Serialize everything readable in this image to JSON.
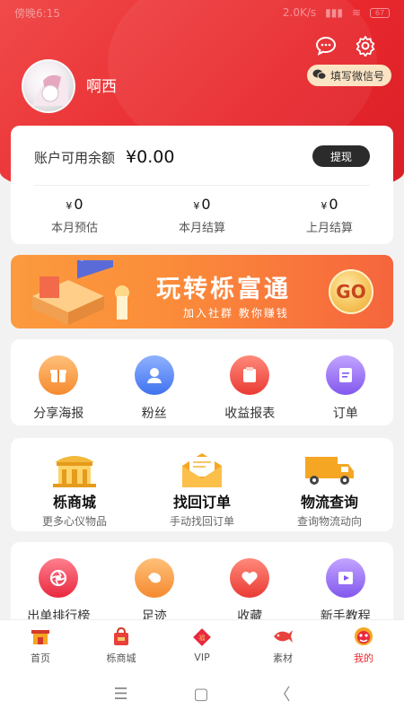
{
  "status": {
    "time": "傍晚6:15",
    "speed": "2.0K/s",
    "battery": "67"
  },
  "header": {
    "username": "啊西",
    "wechat_label": "填写微信号"
  },
  "balance": {
    "label": "账户可用余额",
    "value": "¥0.00",
    "withdraw_label": "提现",
    "stats": [
      {
        "value": "0",
        "currency": "¥",
        "label": "本月预估"
      },
      {
        "value": "0",
        "currency": "¥",
        "label": "本月结算"
      },
      {
        "value": "0",
        "currency": "¥",
        "label": "上月结算"
      }
    ]
  },
  "banner": {
    "title": "玩转栎富通",
    "subtitle": "加入社群 教你赚钱",
    "go": "GO"
  },
  "menu1": [
    {
      "label": "分享海报",
      "icon": "gift-icon",
      "color": "#f7a04a"
    },
    {
      "label": "粉丝",
      "icon": "fans-icon",
      "color": "#5b8cf5"
    },
    {
      "label": "收益报表",
      "icon": "report-icon",
      "color": "#f25a4f"
    },
    {
      "label": "订单",
      "icon": "order-icon",
      "color": "#9a72f2"
    }
  ],
  "menu2": [
    {
      "title": "栎商城",
      "subtitle": "更多心仪物品",
      "icon": "mall-icon"
    },
    {
      "title": "找回订单",
      "subtitle": "手动找回订单",
      "icon": "envelope-icon"
    },
    {
      "title": "物流查询",
      "subtitle": "查询物流动向",
      "icon": "truck-icon"
    }
  ],
  "menu3": [
    {
      "label": "出单排行榜",
      "icon": "aperture-icon",
      "color": "#f2485a"
    },
    {
      "label": "足迹",
      "icon": "footprint-icon",
      "color": "#f7a04a"
    },
    {
      "label": "收藏",
      "icon": "heart-icon",
      "color": "#f25a4f"
    },
    {
      "label": "新手教程",
      "icon": "play-icon",
      "color": "#9a72f2"
    }
  ],
  "tabs": [
    {
      "label": "首页",
      "icon": "home-icon"
    },
    {
      "label": "栎商城",
      "icon": "shopping-bag-icon"
    },
    {
      "label": "VIP",
      "icon": "vip-icon"
    },
    {
      "label": "素材",
      "icon": "fish-icon"
    },
    {
      "label": "我的",
      "icon": "lion-icon",
      "active": true
    }
  ]
}
